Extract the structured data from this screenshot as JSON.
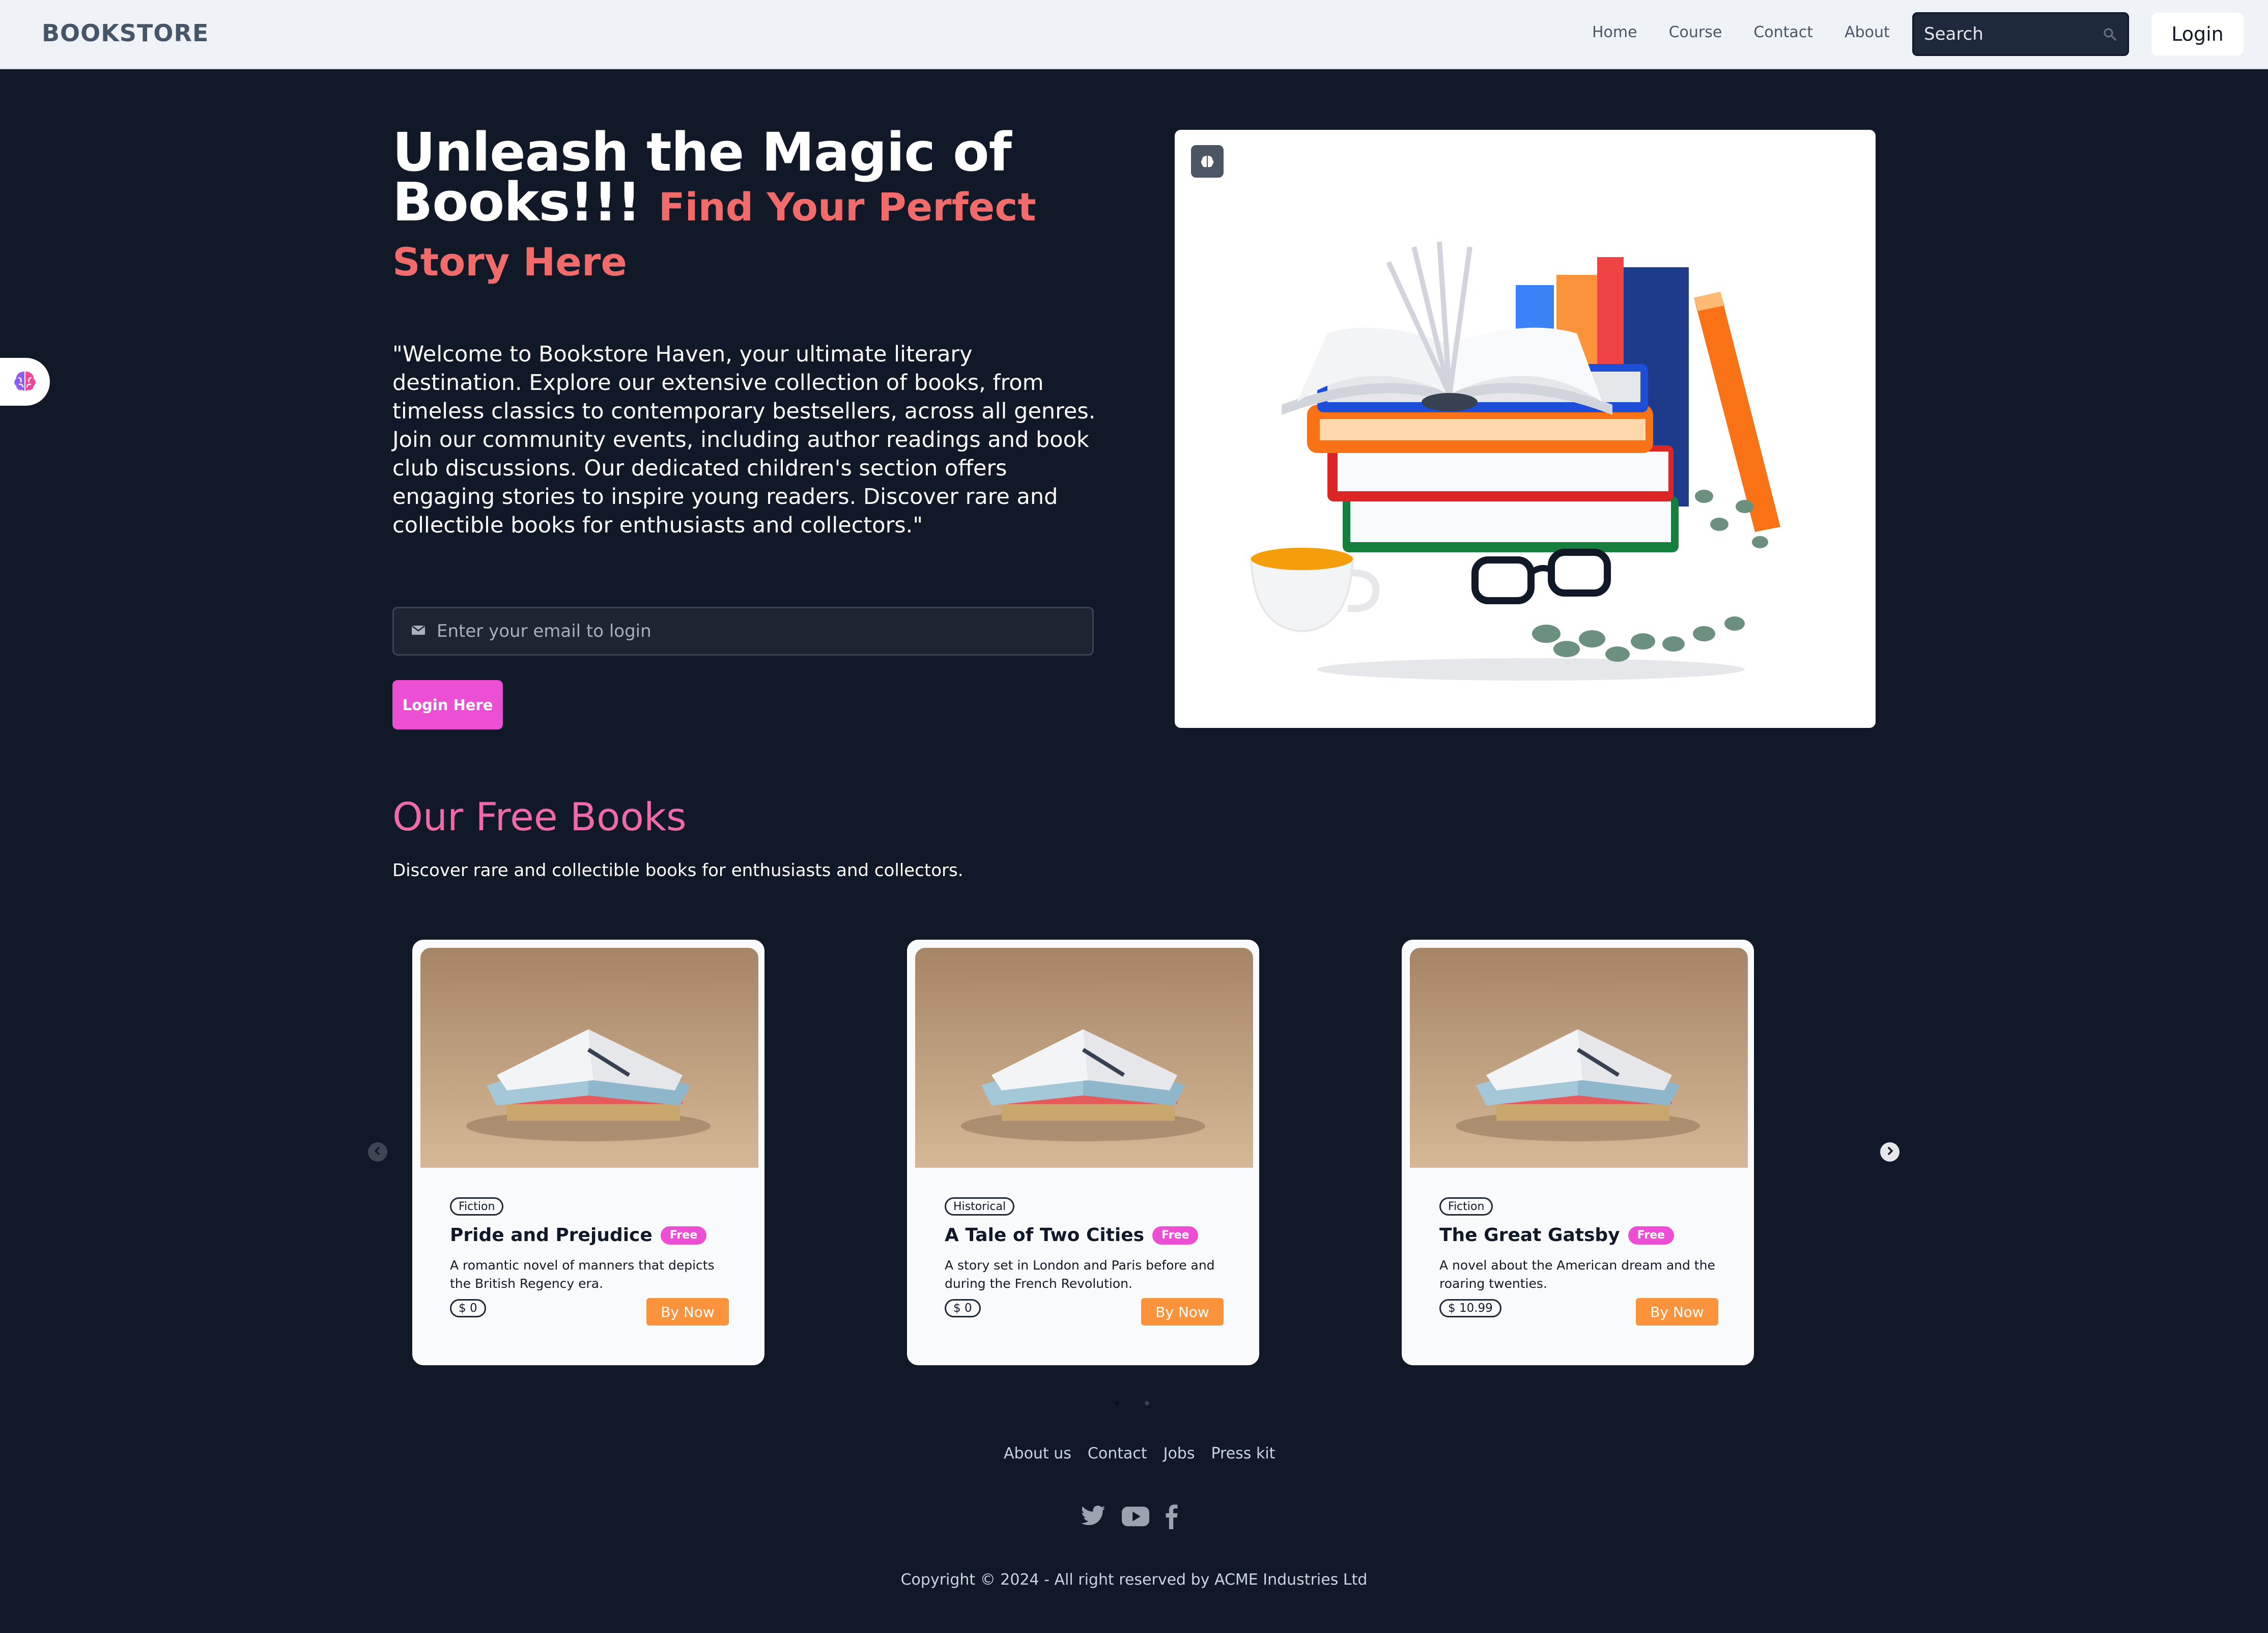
{
  "navbar": {
    "brand": "BOOKSTORE",
    "links": [
      "Home",
      "Course",
      "Contact",
      "About"
    ],
    "search_placeholder": "Search",
    "login_label": "Login"
  },
  "hero": {
    "title_main": "Unleash the Magic of Books!!! ",
    "title_accent": "Find Your Perfect Story Here",
    "description": "\"Welcome to Bookstore Haven, your ultimate literary destination. Explore our extensive collection of books, from timeless classics to contemporary bestsellers, across all genres. Join our community events, including author readings and book club discussions. Our dedicated children's section offers engaging stories to inspire young readers. Discover rare and collectible books for enthusiasts and collectors.\"",
    "email_placeholder": "Enter your email to login",
    "login_button": "Login Here"
  },
  "free_books": {
    "title": "Our Free Books",
    "subtitle": "Discover rare and collectible books for enthusiasts and collectors.",
    "cards": [
      {
        "category": "Fiction",
        "title": "Pride and Prejudice",
        "badge": "Free",
        "description": "A romantic novel of manners that depicts the British Regency era.",
        "price": "$ 0",
        "button": "By Now"
      },
      {
        "category": "Historical",
        "title": "A Tale of Two Cities",
        "badge": "Free",
        "description": "A story set in London and Paris before and during the French Revolution.",
        "price": "$ 0",
        "button": "By Now"
      },
      {
        "category": "Fiction",
        "title": "The Great Gatsby",
        "badge": "Free",
        "description": "A novel about the American dream and the roaring twenties.",
        "price": "$ 10.99",
        "button": "By Now"
      }
    ],
    "active_slide": 1,
    "slide_count": 2
  },
  "footer": {
    "links": [
      "About us",
      "Contact",
      "Jobs",
      "Press kit"
    ],
    "social_icons": [
      "twitter-icon",
      "youtube-icon",
      "facebook-icon"
    ],
    "copyright": "Copyright © 2024 - All right reserved by ACME Industries Ltd"
  },
  "colors": {
    "background": "#111827",
    "navbar": "#eff3f8",
    "accent_pink": "#ec4fd4",
    "title_accent": "#f26b6b",
    "section_title": "#f06aa8",
    "buy_button": "#fb923c"
  }
}
